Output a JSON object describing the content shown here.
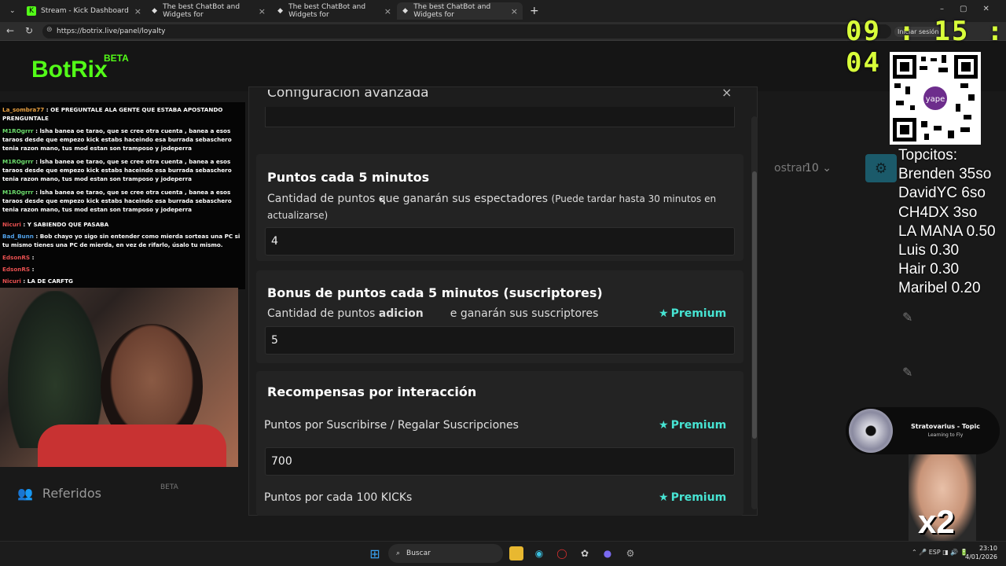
{
  "browser": {
    "tabs": [
      {
        "label": "Stream - Kick Dashboard",
        "active": false
      },
      {
        "label": "The best ChatBot and Widgets for",
        "active": false
      },
      {
        "label": "The best ChatBot and Widgets for",
        "active": false
      },
      {
        "label": "The best ChatBot and Widgets for",
        "active": true
      }
    ],
    "url": "https://botrix.live/panel/loyalty",
    "signin_label": "Iniciar sesión",
    "new_tab": "+"
  },
  "app": {
    "logo": "BotRix",
    "beta": "BETA"
  },
  "modal": {
    "title": "Configuración avanzada",
    "close": "×",
    "sections": {
      "points": {
        "heading": "Puntos cada 5 minutos",
        "description": "Cantidad de puntos que ganarán sus espectadores",
        "note": "(Puede tardar hasta 30 minutos en actualizarse)",
        "value": "4"
      },
      "bonus": {
        "heading": "Bonus de puntos cada 5 minutos (suscriptores)",
        "description_start": "Cantidad de puntos ",
        "description_bold": "adicion",
        "description_end": "e ganarán sus suscriptores",
        "premium": "Premium",
        "value": "5"
      },
      "rewards": {
        "heading": "Recompensas por interacción",
        "sub_label": "Puntos por Suscribirse / Regalar Suscripciones",
        "sub_premium": "Premium",
        "sub_value": "700",
        "kicks_label": "Puntos por cada 100 KICKs",
        "kicks_premium": "Premium"
      }
    }
  },
  "background": {
    "mostrar": "ostrar:",
    "page_size": "10",
    "referidos": "Referidos",
    "referidos_beta": "BETA"
  },
  "chat": [
    {
      "user": "La_sombra77",
      "text": ": OE PREGUNTALE ALA GENTE QUE ESTABA APOSTANDO PRENGUNTALE",
      "color": "#e8a040"
    },
    {
      "user": "M1ROgrrr",
      "text": ": lsha banea oe tarao, que se cree otra cuenta , banea a esos taraos desde que empezo kick estabs haceindo esa burrada sebaschero tenia razon mano, tus mod estan son tramposo y jodeperra",
      "color": "#6cde6c"
    },
    {
      "user": "M1ROgrrr",
      "text": ": lsha banea oe tarao, que se cree otra cuenta , banea a esos taraos desde que empezo kick estabs haceindo esa burrada sebaschero tenia razon mano, tus mod estan son tramposo y jodeperra",
      "color": "#6cde6c"
    },
    {
      "user": "M1ROgrrr",
      "text": ": lsha banea oe tarao, que se cree otra cuenta , banea a esos taraos desde que empezo kick estabs haceindo esa burrada sebaschero tenia razon mano, tus mod estan son tramposo y jodeperra",
      "color": "#6cde6c"
    },
    {
      "user": "Nicuri",
      "text": ": Y SABIENDO QUE PASABA",
      "color": "#e85050"
    },
    {
      "user": "Bad_Bunn",
      "text": ": Bob chayo yo sigo sin entender como mierda sorteas una PC si tu mismo tienes una PC de mierda, en vez de rifarlo, úsalo tu mismo.",
      "color": "#50a0e8"
    },
    {
      "user": "EdsonRS",
      "text": ":",
      "color": "#e85050"
    },
    {
      "user": "EdsonRS",
      "text": ":",
      "color": "#e85050"
    },
    {
      "user": "Nicuri",
      "text": ": LA DE CARFTG",
      "color": "#e85050"
    }
  ],
  "overlay": {
    "clock": "09 : 15 : 04",
    "topcitos_title": "Topcitos:",
    "topcitos": [
      "Brenden 35so",
      "DavidYC 6so",
      "CH4DX 3so",
      "LA MANA 0.50",
      "Luis 0.30",
      "Hair 0.30",
      "Maribel 0.20"
    ],
    "qr_label": "yape",
    "music_title": "Stratovarius - Topic",
    "music_subtitle": "Learning to Fly",
    "x2": "x2"
  },
  "taskbar": {
    "search": "Buscar",
    "lang": "ESP",
    "time": "23:10",
    "date": "4/01/2026"
  },
  "colors": {
    "brand": "#53fc18",
    "premium": "#47e4d3"
  }
}
